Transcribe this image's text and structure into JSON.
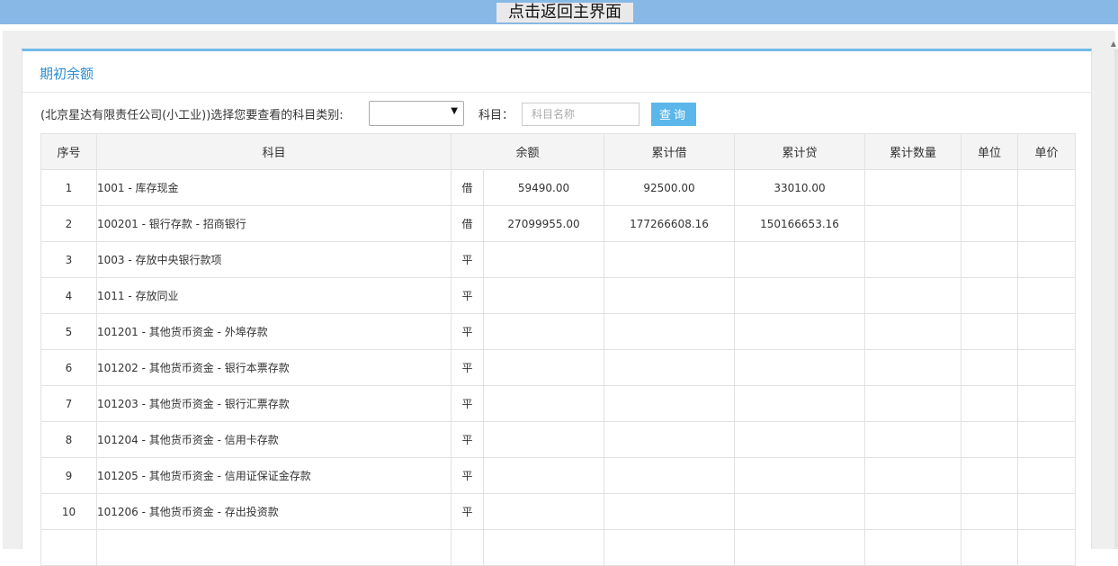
{
  "topbar": {
    "back_label": "点击返回主界面"
  },
  "panel": {
    "title": "期初余额",
    "prompt": "(北京星达有限责任公司(小工业))选择您要查看的科目类别:",
    "category_select": {
      "selected": ""
    },
    "subject_label": "科目：",
    "subject_placeholder": "科目名称",
    "subject_value": "",
    "query_label": "查询"
  },
  "table": {
    "columns": [
      "序号",
      "科目",
      "余额",
      "累计借",
      "累计贷",
      "累计数量",
      "单位",
      "单价"
    ],
    "rows": [
      {
        "idx": "1",
        "subject": "1001 - 库存现金",
        "dir": "借",
        "balance": "59490.00",
        "debit": "92500.00",
        "credit": "33010.00",
        "qty": "",
        "unit": "",
        "price": ""
      },
      {
        "idx": "2",
        "subject": "100201 - 银行存款 - 招商银行",
        "dir": "借",
        "balance": "27099955.00",
        "debit": "177266608.16",
        "credit": "150166653.16",
        "qty": "",
        "unit": "",
        "price": ""
      },
      {
        "idx": "3",
        "subject": "1003 - 存放中央银行款项",
        "dir": "平",
        "balance": "",
        "debit": "",
        "credit": "",
        "qty": "",
        "unit": "",
        "price": ""
      },
      {
        "idx": "4",
        "subject": "1011 - 存放同业",
        "dir": "平",
        "balance": "",
        "debit": "",
        "credit": "",
        "qty": "",
        "unit": "",
        "price": ""
      },
      {
        "idx": "5",
        "subject": "101201 - 其他货币资金 - 外埠存款",
        "dir": "平",
        "balance": "",
        "debit": "",
        "credit": "",
        "qty": "",
        "unit": "",
        "price": ""
      },
      {
        "idx": "6",
        "subject": "101202 - 其他货币资金 - 银行本票存款",
        "dir": "平",
        "balance": "",
        "debit": "",
        "credit": "",
        "qty": "",
        "unit": "",
        "price": ""
      },
      {
        "idx": "7",
        "subject": "101203 - 其他货币资金 - 银行汇票存款",
        "dir": "平",
        "balance": "",
        "debit": "",
        "credit": "",
        "qty": "",
        "unit": "",
        "price": ""
      },
      {
        "idx": "8",
        "subject": "101204 - 其他货币资金 - 信用卡存款",
        "dir": "平",
        "balance": "",
        "debit": "",
        "credit": "",
        "qty": "",
        "unit": "",
        "price": ""
      },
      {
        "idx": "9",
        "subject": "101205 - 其他货币资金 - 信用证保证金存款",
        "dir": "平",
        "balance": "",
        "debit": "",
        "credit": "",
        "qty": "",
        "unit": "",
        "price": ""
      },
      {
        "idx": "10",
        "subject": "101206 - 其他货币资金 - 存出投资款",
        "dir": "平",
        "balance": "",
        "debit": "",
        "credit": "",
        "qty": "",
        "unit": "",
        "price": ""
      },
      {
        "idx": "",
        "subject": "",
        "dir": "",
        "balance": "",
        "debit": "",
        "credit": "",
        "qty": "",
        "unit": "",
        "price": ""
      }
    ]
  }
}
